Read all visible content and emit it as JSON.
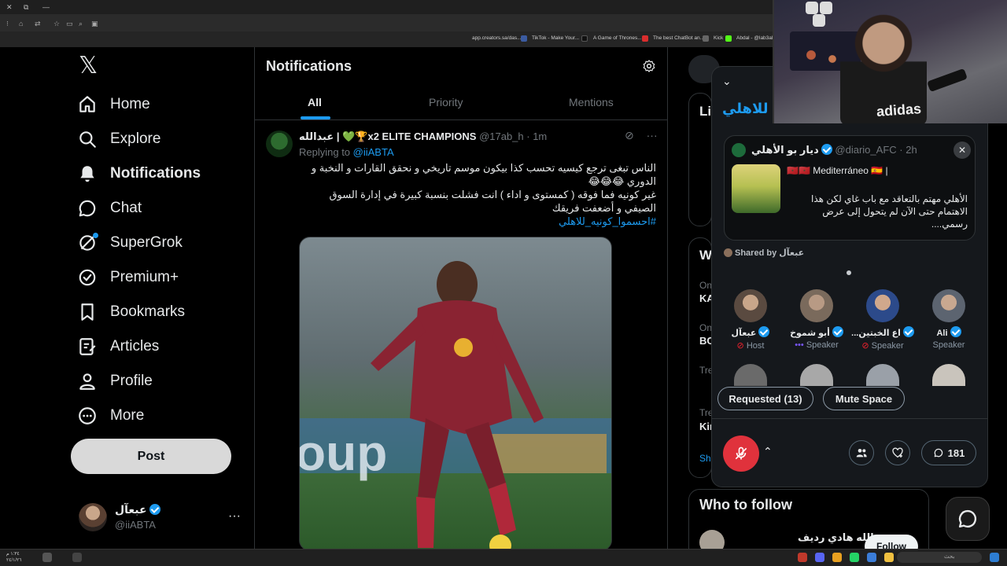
{
  "browser": {
    "bookmarks": [
      "app.creators.sa/das...",
      "TikTok - Make Your...",
      "A Game of Thrones...",
      "The best ChatBot an...",
      "Kick",
      "Abdal - @lab3al"
    ]
  },
  "nav": {
    "items": [
      {
        "name": "home",
        "label": "Home",
        "icon": "home-icon"
      },
      {
        "name": "explore",
        "label": "Explore",
        "icon": "search-icon"
      },
      {
        "name": "notifications",
        "label": "Notifications",
        "icon": "bell-icon"
      },
      {
        "name": "chat",
        "label": "Chat",
        "icon": "chat-icon"
      },
      {
        "name": "supergrok",
        "label": "SuperGrok",
        "icon": "grok-icon"
      },
      {
        "name": "premium",
        "label": "Premium+",
        "icon": "verified-badge-icon"
      },
      {
        "name": "bookmarks",
        "label": "Bookmarks",
        "icon": "bookmark-icon"
      },
      {
        "name": "articles",
        "label": "Articles",
        "icon": "article-icon"
      },
      {
        "name": "profile",
        "label": "Profile",
        "icon": "person-icon"
      },
      {
        "name": "more",
        "label": "More",
        "icon": "more-circle-icon"
      }
    ],
    "post_label": "Post",
    "account": {
      "name": "عبعآل",
      "handle": "@iiABTA",
      "more": "···"
    }
  },
  "notifications": {
    "title": "Notifications",
    "tabs": [
      "All",
      "Priority",
      "Mentions"
    ],
    "active_tab": "All"
  },
  "post": {
    "author": "عبدالله | 💚🏆x2 ELITE CHAMPIONS",
    "handle": "@17ab_h",
    "time": "· 1m",
    "replying_label": "Replying to ",
    "replying_handle": "@iiABTA",
    "text_1": "الناس تبغى ترجع كيسيه تحسب كذا بيكون موسم تاريخي و نحقق القارات و النخبة و الدوري 😂😂😂",
    "text_2": "غير كونيه فما فوقه ( كمستوى و اداء ) انت فشلت بنسبة كبيرة في إدارة السوق الصيفي و أضعفت فريقك",
    "hashtag": "#احسموا_كونيه_للاهلي",
    "more": "···"
  },
  "space": {
    "title": "للاهلي",
    "card": {
      "author": "ديار بو الأهلي",
      "handle": "@diario_AFC",
      "time": "· 2h",
      "flag_line": "🇲🇦🇲🇦 Mediterráneo 🇪🇸 |",
      "text": "الأهلي مهتم بالتعاقد مع باب غاي لكن هذا الاهتمام حتى الآن لم يتحول إلى عرض رسمي....",
      "close": "✕"
    },
    "shared_by": "Shared by عبعآل",
    "speakers": [
      {
        "name": "عبعآل",
        "role": "Host",
        "role_icon": "muted-mic-icon",
        "color": "#5a4a40"
      },
      {
        "name": "أبو شموخ",
        "role": "Speaker",
        "role_icon": "speaking-dots-icon",
        "color": "#7a6a5c"
      },
      {
        "name": "...اع الخبتين",
        "role": "Speaker",
        "role_icon": "muted-mic-icon",
        "color": "#2c4a8a"
      },
      {
        "name": "Ali",
        "role": "Speaker",
        "role_icon": "",
        "color": "#5c6470"
      }
    ],
    "requested_label": "Requested (13)",
    "mute_label": "Mute Space",
    "reply_count": "181"
  },
  "right": {
    "who_to_follow": "Who to follow",
    "suggestion_name": "عبدالله هادي رديف",
    "follow_label": "Follow",
    "fragments": [
      "Li",
      "W",
      "On",
      "KA",
      "On",
      "BC",
      "Tre",
      "Tre",
      "Kir",
      "Sh"
    ]
  },
  "webcam": {
    "shirt_text": "adidas"
  },
  "taskbar": {
    "time": "١:٣٤ م",
    "date": "٢٤/١/٢٦",
    "search_text": "بحث"
  }
}
